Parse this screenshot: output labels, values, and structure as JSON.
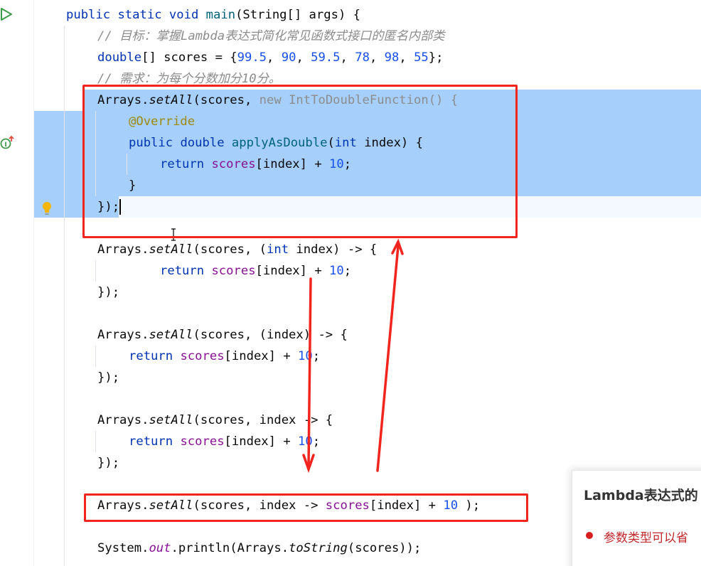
{
  "code": {
    "main_signature": {
      "kw1": "public",
      "kw2": "static",
      "kw3": "void",
      "name": "main",
      "params": "(String[] args) {"
    },
    "comment_goal": "// 目标：掌握Lambda表达式简化常见函数式接口的匿名内部类",
    "scores_decl": {
      "type": "double",
      "rest": "[] scores = {",
      "values": [
        "99.5",
        "90",
        "59.5",
        "78",
        "98",
        "55"
      ],
      "end": "};"
    },
    "comment_need": "// 需求：为每个分数加分10分。",
    "anon": {
      "call": "Arrays.",
      "method": "setAll",
      "args_start": "(scores, ",
      "new_kw": "new",
      "iface": "IntToDoubleFunction",
      "args_end": "() {",
      "override": "@Override",
      "sig_public": "public",
      "sig_double": "double",
      "sig_name": "applyAsDouble",
      "sig_param_open": "(",
      "sig_int": "int",
      "sig_param_rest": " index) {",
      "ret_kw": "return",
      "ret_field": "scores",
      "ret_rest": "[index] + ",
      "ret_num": "10",
      "ret_end": ";",
      "close_inner": "}",
      "close_outer": "});"
    },
    "lambda1": {
      "call": "Arrays.",
      "method": "setAll",
      "args": "(scores, (",
      "int_kw": "int",
      "rest": " index) -> {",
      "ret_kw": "return",
      "ret_field": "scores",
      "ret_rest": "[index] + ",
      "ret_num": "10",
      "ret_end": ";",
      "close": "});"
    },
    "lambda2": {
      "call": "Arrays.",
      "method": "setAll",
      "args": "(scores, (index) -> {",
      "ret_kw": "return",
      "ret_field": "scores",
      "ret_rest": "[index] + ",
      "ret_num": "10",
      "ret_end": ";",
      "close": "});"
    },
    "lambda3": {
      "call": "Arrays.",
      "method": "setAll",
      "args": "(scores, index -> {",
      "ret_kw": "return",
      "ret_field": "scores",
      "ret_rest": "[index] + ",
      "ret_num": "10",
      "ret_end": ";",
      "close": "});"
    },
    "lambda4": {
      "call": "Arrays.",
      "method": "setAll",
      "args": "(scores, index -> ",
      "field": "scores",
      "rest": "[index] + ",
      "num": "10",
      "end": " );"
    },
    "println": {
      "prefix": "System.",
      "out": "out",
      "mid": ".println(Arrays.",
      "method": "toString",
      "end": "(scores));"
    }
  },
  "gutter_icons": [
    "run-icon",
    "implement-method-icon",
    "intention-bulb-icon"
  ],
  "card": {
    "title": "Lambda表达式的",
    "bullet": "参数类型可以省"
  },
  "colors": {
    "selection": "#a6d0fb",
    "annotation_red": "#f2251e",
    "keyword": "#0033b3",
    "number": "#1750eb",
    "field": "#871094",
    "method": "#00627a",
    "comment": "#8c8c8c",
    "annotation": "#9e880d"
  }
}
